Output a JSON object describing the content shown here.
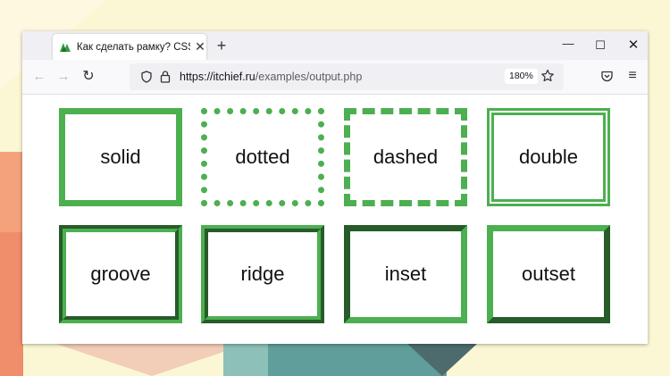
{
  "browser": {
    "tab_title": "Как сделать рамку? CSS-свойс",
    "tab_close": "✕",
    "new_tab": "+",
    "url_host": "https://itchief.ru",
    "url_path": "/examples/output.php",
    "zoom": "180%",
    "minimize": "—",
    "maximize": "☐",
    "close": "✕",
    "back": "←",
    "forward": "→",
    "reload": "↻",
    "menu": "≡"
  },
  "boxes": [
    {
      "label": "solid"
    },
    {
      "label": "dotted"
    },
    {
      "label": "dashed"
    },
    {
      "label": "double"
    },
    {
      "label": "groove"
    },
    {
      "label": "ridge"
    },
    {
      "label": "inset"
    },
    {
      "label": "outset"
    }
  ],
  "colors": {
    "border_green": "#4caf50",
    "background": "#fbf7d5"
  }
}
